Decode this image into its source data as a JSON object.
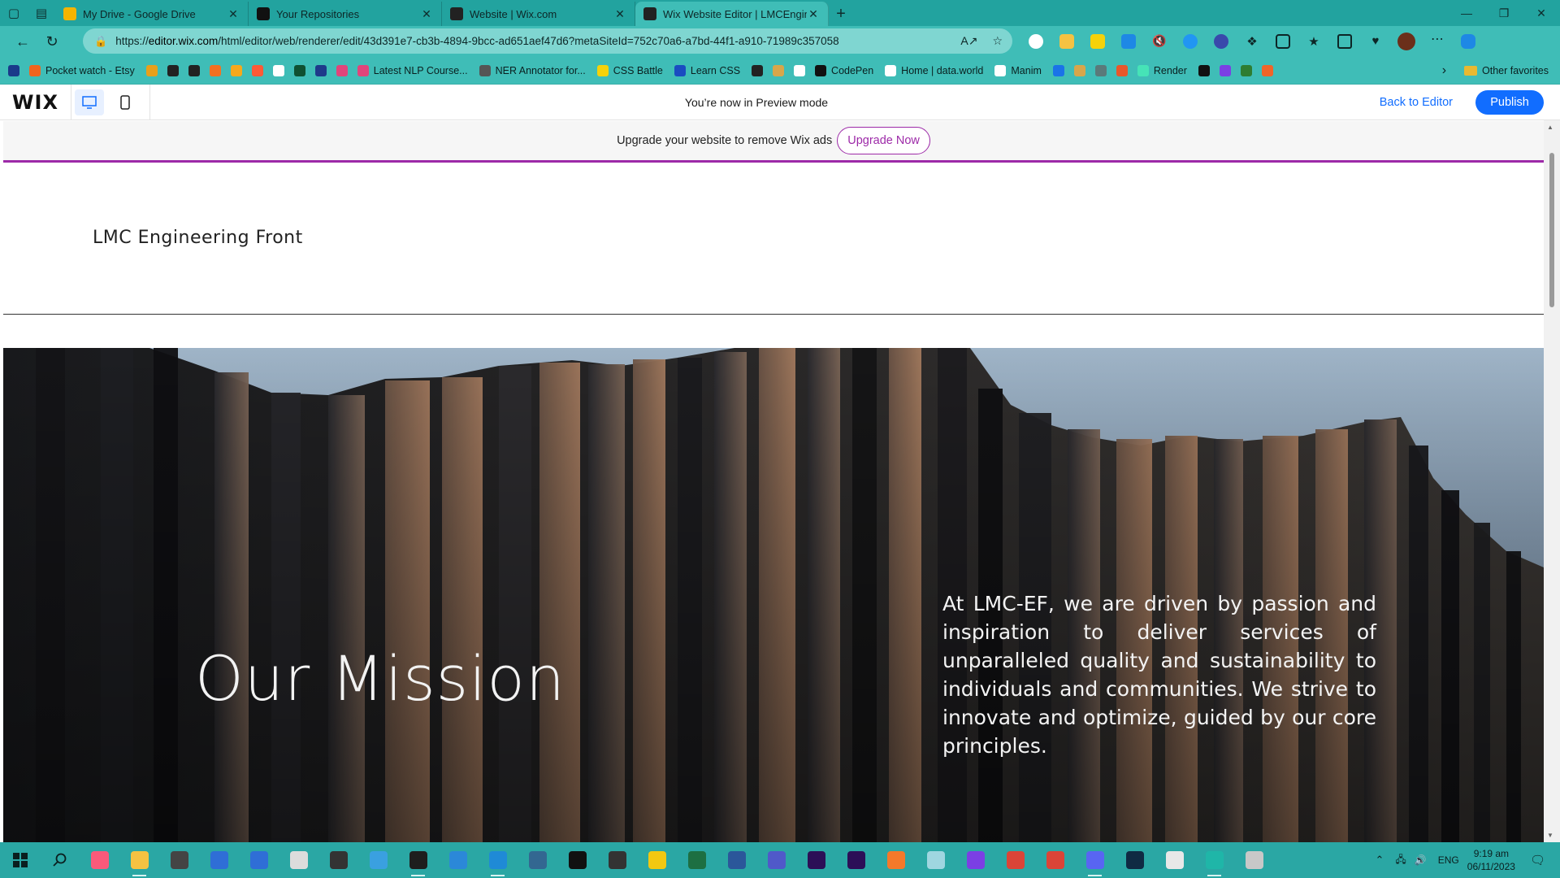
{
  "browser": {
    "tabs": [
      {
        "title": "My Drive - Google Drive",
        "favicon": "google-drive-icon",
        "color": "#f4b400",
        "active": false
      },
      {
        "title": "Your Repositories",
        "favicon": "github-icon",
        "color": "#111111",
        "active": false
      },
      {
        "title": "Website | Wix.com",
        "favicon": "wix-icon",
        "color": "#222222",
        "active": false
      },
      {
        "title": "Wix Website Editor | LMCEngine",
        "favicon": "wix-icon",
        "color": "#222222",
        "active": true
      }
    ],
    "url_prefix": "https://",
    "url_host": "editor.wix.com",
    "url_rest": "/html/editor/web/renderer/edit/43d391e7-cb3b-4894-9bcc-ad651aef47d6?metaSiteId=752c70a6-a7bd-44f1-a910-71989c357058",
    "bookmarks": [
      {
        "label": "Pocket watch - Etsy",
        "color": "#f1641e"
      },
      {
        "label": "",
        "color": "#e9a01b"
      },
      {
        "label": "",
        "color": "#222222"
      },
      {
        "label": "",
        "color": "#222222"
      },
      {
        "label": "",
        "color": "#f37021"
      },
      {
        "label": "",
        "color": "#f7a81b"
      },
      {
        "label": "",
        "color": "#ff5a36"
      },
      {
        "label": "",
        "color": "#ffffff"
      },
      {
        "label": "",
        "color": "#0f5132"
      },
      {
        "label": "",
        "color": "#1e3a8a"
      },
      {
        "label": "",
        "color": "#e0457b"
      },
      {
        "label": "Latest NLP Course...",
        "color": "#e0457b"
      },
      {
        "label": "NER Annotator for...",
        "color": "#555555"
      },
      {
        "label": "CSS Battle",
        "color": "#f5d20a"
      },
      {
        "label": "Learn CSS",
        "color": "#1a4cc1"
      },
      {
        "label": "",
        "color": "#222222"
      },
      {
        "label": "",
        "color": "#d8a64a"
      },
      {
        "label": "",
        "color": "#ffffff"
      },
      {
        "label": "CodePen",
        "color": "#111111"
      },
      {
        "label": "Home | data.world",
        "color": "#ffffff"
      },
      {
        "label": "Manim",
        "color": "#ffffff"
      },
      {
        "label": "",
        "color": "#1a73e8"
      },
      {
        "label": "",
        "color": "#d8a64a"
      },
      {
        "label": "",
        "color": "#5a7a7a"
      },
      {
        "label": "",
        "color": "#e8572b"
      },
      {
        "label": "Render",
        "color": "#46e3b7"
      },
      {
        "label": "",
        "color": "#111111"
      },
      {
        "label": "",
        "color": "#7b3fe4"
      },
      {
        "label": "",
        "color": "#2e7d32"
      },
      {
        "label": "",
        "color": "#f06529"
      }
    ],
    "other_favorites": "Other favorites"
  },
  "editor": {
    "logo": "WIX",
    "preview_message": "You’re now in Preview mode",
    "back_to_editor": "Back to Editor",
    "publish": "Publish",
    "ad_text": "Upgrade your website to remove Wix ads",
    "upgrade_button": "Upgrade Now"
  },
  "site": {
    "title": "LMC Engineering Front",
    "hero_heading": "Our Mission",
    "hero_text": "At LMC-EF, we are driven by passion and inspiration to deliver services of unparalleled quality and sustainability to individuals and communities. We strive to innovate and optimize, guided by our core principles."
  },
  "taskbar": {
    "apps": [
      {
        "name": "itunes-icon",
        "color": "#fa5a7a"
      },
      {
        "name": "file-explorer-icon",
        "color": "#f5c242",
        "running": true
      },
      {
        "name": "calculator-icon",
        "color": "#444444"
      },
      {
        "name": "app-blue-icon",
        "color": "#2f6ed6"
      },
      {
        "name": "app-people-icon",
        "color": "#2f6ed6"
      },
      {
        "name": "app-cloud-icon",
        "color": "#dcdcdc"
      },
      {
        "name": "settings-icon",
        "color": "#333333"
      },
      {
        "name": "app-photo-icon",
        "color": "#3aa0e0"
      },
      {
        "name": "terminal-icon",
        "color": "#1e1e1e",
        "running": true
      },
      {
        "name": "app-refresh-icon",
        "color": "#2b88d8"
      },
      {
        "name": "vscode-icon",
        "color": "#1f8ad6",
        "running": true
      },
      {
        "name": "postgres-icon",
        "color": "#336791"
      },
      {
        "name": "notion-icon",
        "color": "#111111"
      },
      {
        "name": "arrow-app-icon",
        "color": "#333333"
      },
      {
        "name": "powerbi-icon",
        "color": "#f2c811"
      },
      {
        "name": "excel-icon",
        "color": "#1d6f42"
      },
      {
        "name": "word-icon",
        "color": "#2b579a"
      },
      {
        "name": "teams-icon",
        "color": "#5059c9"
      },
      {
        "name": "after-effects-icon",
        "color": "#2c0f57"
      },
      {
        "name": "premiere-icon",
        "color": "#2c0f57"
      },
      {
        "name": "blender-icon",
        "color": "#f5792a"
      },
      {
        "name": "app-draw-icon",
        "color": "#9fd6e0"
      },
      {
        "name": "messenger-icon",
        "color": "#7b3fe4"
      },
      {
        "name": "chrome-icon",
        "color": "#db4437"
      },
      {
        "name": "chrome-alt-icon",
        "color": "#db4437"
      },
      {
        "name": "discord-icon",
        "color": "#5865f2",
        "running": true
      },
      {
        "name": "photoshop-icon",
        "color": "#0f2a43"
      },
      {
        "name": "app-mesh-icon",
        "color": "#e8e8e8"
      },
      {
        "name": "edge-icon",
        "color": "#1fb6a8",
        "running": true
      },
      {
        "name": "app-paint-icon",
        "color": "#c8c8c8"
      }
    ],
    "language": "ENG",
    "time": "9:19 am",
    "date": "06/11/2023"
  }
}
